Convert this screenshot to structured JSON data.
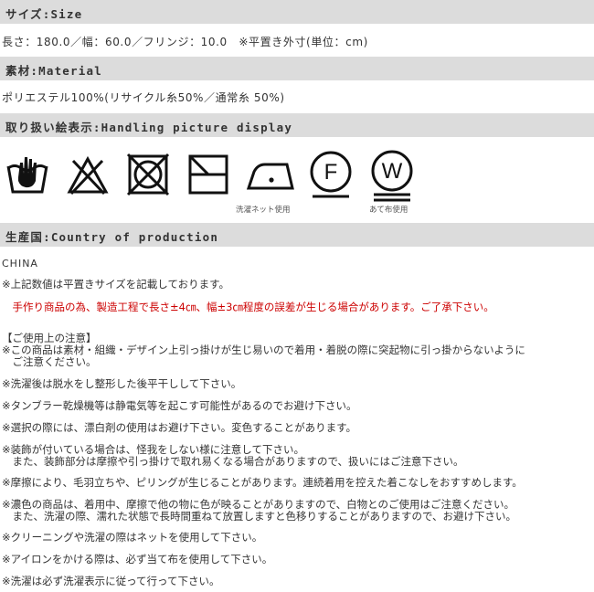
{
  "size": {
    "header": "サイズ:Size",
    "text": "長さ：180.0／幅：60.0／フリンジ：10.0　※平置き外寸(単位：cm)"
  },
  "material": {
    "header": "素材:Material",
    "text": "ポリエステル100%(リサイクル糸50%／通常糸 50%)"
  },
  "handling": {
    "header": "取り扱い絵表示:Handling picture display",
    "icons": [
      {
        "name": "hand-wash-icon"
      },
      {
        "name": "no-bleach-icon"
      },
      {
        "name": "no-tumble-dry-icon"
      },
      {
        "name": "line-dry-shade-icon"
      },
      {
        "name": "low-iron-icon",
        "caption": "洗濯ネット使用"
      },
      {
        "name": "dry-clean-f-icon",
        "letter": "F"
      },
      {
        "name": "wet-clean-w-icon",
        "letter": "W",
        "caption": "あて布使用"
      }
    ]
  },
  "origin": {
    "header": "生産国:Country of production",
    "country": "CHINA"
  },
  "notes": {
    "n1": "※上記数値は平置きサイズを記載しております。",
    "n2": "　手作り商品の為、製造工程で長さ±4㎝、幅±3㎝程度の誤差が生じる場合があります。ご了承下さい。",
    "caution_title": "【ご使用上の注意】",
    "c1a": "※この商品は素材・組織・デザイン上引っ掛けが生じ易いので着用・着脱の際に突起物に引っ掛からないように",
    "c1b": "　ご注意ください。",
    "c2": "※洗濯後は脱水をし整形した後平干しして下さい。",
    "c3": "※タンブラー乾燥機等は静電気等を起こす可能性があるのでお避け下さい。",
    "c4": "※選択の際には、漂白剤の使用はお避け下さい。変色することがあります。",
    "c5a": "※装飾が付いている場合は、怪我をしない様に注意して下さい。",
    "c5b": "　また、装飾部分は摩擦や引っ掛けで取れ易くなる場合がありますので、扱いにはご注意下さい。",
    "c6": "※摩擦により、毛羽立ちや、ピリングが生じることがあります。連続着用を控えた着こなしをおすすめします。",
    "c7a": "※濃色の商品は、着用中、摩擦で他の物に色が映ることがありますので、白物とのご使用はご注意ください。",
    "c7b": "　また、洗濯の際、濡れた状態で長時間重ねて放置しますと色移りすることがありますので、お避け下さい。",
    "c8": "※クリーニングや洗濯の際はネットを使用して下さい。",
    "c9": "※アイロンをかける際は、必ず当て布を使用して下さい。",
    "c10": "※洗濯は必ず洗濯表示に従って行って下さい。"
  }
}
